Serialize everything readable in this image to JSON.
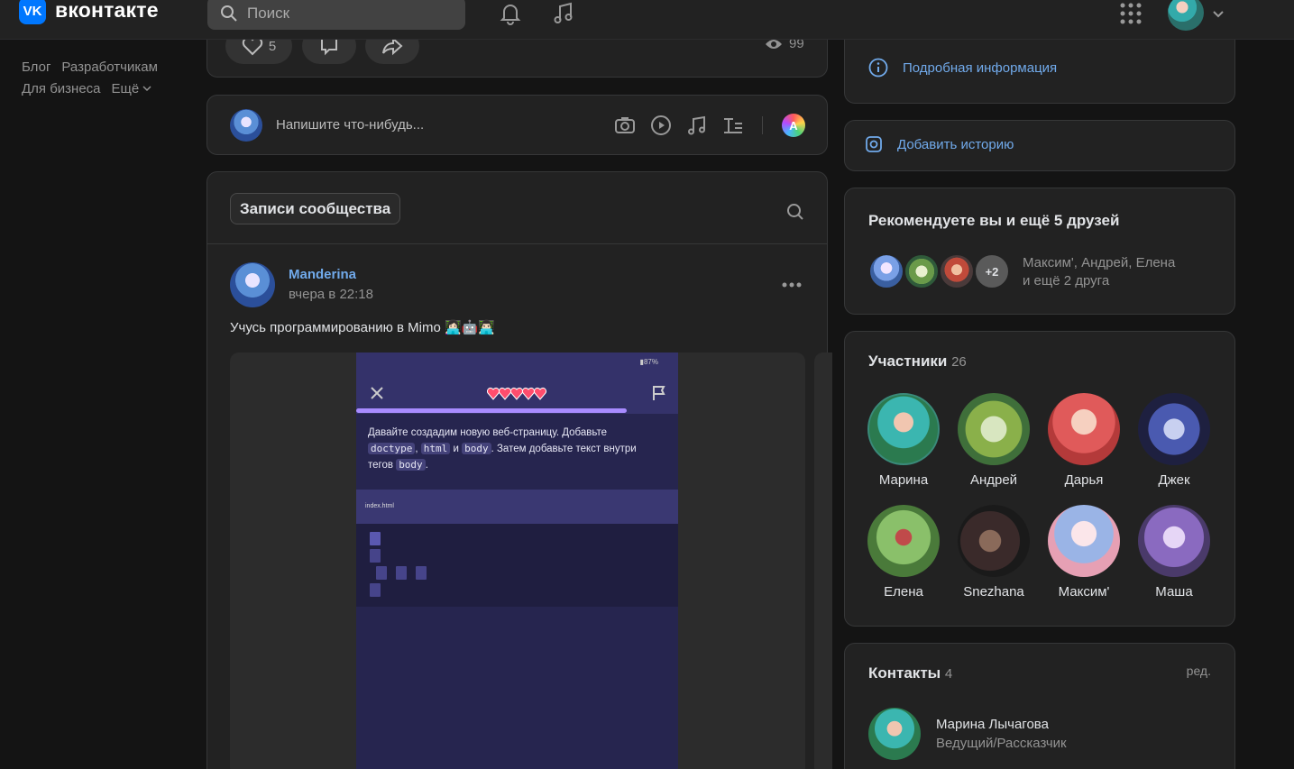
{
  "header": {
    "logo_text": "вконтакте",
    "search_placeholder": "Поиск"
  },
  "leftnav": {
    "links": [
      "Блог",
      "Разработчикам",
      "Для бизнеса",
      "Ещё"
    ]
  },
  "prev_post": {
    "likes": "5",
    "views": "99"
  },
  "composer": {
    "placeholder": "Напишите что-нибудь..."
  },
  "wall": {
    "tab_label": "Записи сообщества",
    "post": {
      "author": "Manderina",
      "time": "вчера в 22:18",
      "text": "Учусь программированию в Mimo 👩🏻‍💻🤖👨🏻‍💻",
      "screen": {
        "battery": "▮87%",
        "instruction_1": "Давайте создадим новую веб-страницу. Добавьте",
        "code_doctype": "doctype",
        "code_html": "html",
        "code_body": "body",
        "and_word": "и",
        "instruction_2": ". Затем добавьте текст внутри",
        "instruction_3": "тегов",
        "file_name": "index.html"
      }
    }
  },
  "sidebar": {
    "info_link": "Подробная информация",
    "add_story": "Добавить историю",
    "recommend": {
      "title": "Рекомендуете вы и ещё 5 друзей",
      "plus_count": "+2",
      "names_line1": "Максим', Андрей, Елена",
      "names_line2": "и ещё 2 друга"
    },
    "members": {
      "title": "Участники",
      "count": "26",
      "list": [
        "Марина",
        "Андрей",
        "Дарья",
        "Джек",
        "Елена",
        "Snezhana",
        "Максим'",
        "Маша"
      ]
    },
    "contacts": {
      "title": "Контакты",
      "count": "4",
      "edit": "ред.",
      "name": "Марина Лычагова",
      "role": "Ведущий/Рассказчик"
    }
  },
  "colors": {
    "accent": "#71aaeb",
    "brand": "#0077ff",
    "bg": "#141414",
    "card": "#222222"
  }
}
